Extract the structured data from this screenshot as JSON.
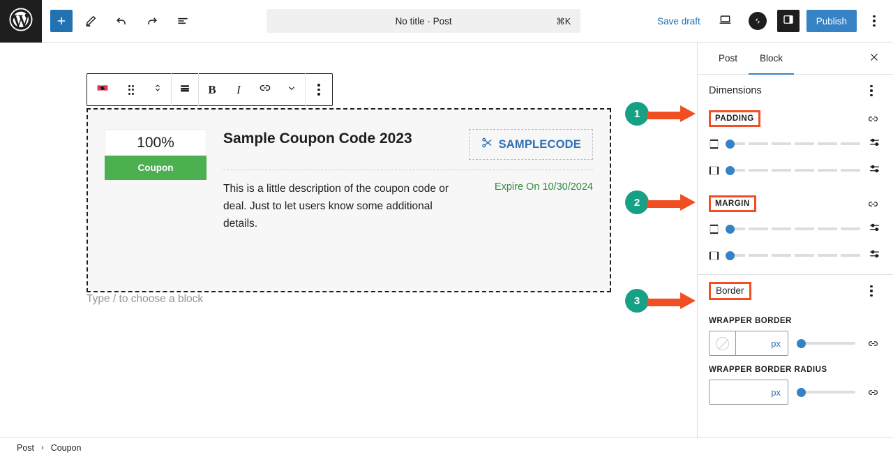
{
  "topbar": {
    "logo_icon": "wordpress-logo",
    "add_block_label": "+",
    "add_block_icon": "plus-icon",
    "tools_icon": "pencil-icon",
    "undo_icon": "undo-arrow-icon",
    "redo_icon": "redo-arrow-icon",
    "list_view_icon": "document-overview-icon",
    "document_title": "No title · Post",
    "command_shortcut": "⌘K",
    "save_draft_label": "Save draft",
    "preview_icon": "laptop-preview-icon",
    "jetpack_icon": "jetpack-icon",
    "settings_toggle_icon": "settings-sidebar-icon",
    "publish_label": "Publish",
    "options_icon": "kebab-menu-icon"
  },
  "block_toolbar": {
    "block_type_icon": "coupon-block-icon",
    "drag_icon": "drag-handle-icon",
    "move_icon": "move-up-down-icon",
    "align_icon": "align-icon",
    "bold_label": "B",
    "italic_label": "I",
    "link_icon": "link-icon",
    "more_formats_icon": "chevron-down-icon",
    "options_icon": "kebab-menu-icon"
  },
  "coupon_block": {
    "discount": "100%",
    "badge_label": "Coupon",
    "title": "Sample Coupon Code 2023",
    "code": "SAMPLECODE",
    "code_icon": "scissors-icon",
    "description": "This is a little description of the coupon code or deal. Just to let users know some additional details.",
    "expire": "Expire On 10/30/2024",
    "badge_color": "#4caf50",
    "code_color": "#2d6fb5",
    "expire_color": "#2e8b3d"
  },
  "canvas": {
    "placeholder": "Type / to choose a block"
  },
  "sidebar": {
    "tabs": [
      {
        "label": "Post",
        "active": false
      },
      {
        "label": "Block",
        "active": true
      }
    ],
    "close_icon": "close-icon",
    "dimensions": {
      "title": "Dimensions",
      "options_icon": "kebab-menu-icon",
      "padding": {
        "label": "PADDING",
        "link_icon": "link-sides-icon",
        "sliders": [
          {
            "edge_icon": "vertical-sides-icon",
            "value": 0,
            "settings_icon": "slider-options-icon"
          },
          {
            "edge_icon": "horizontal-sides-icon",
            "value": 0,
            "settings_icon": "slider-options-icon"
          }
        ]
      },
      "margin": {
        "label": "MARGIN",
        "link_icon": "link-sides-icon",
        "sliders": [
          {
            "edge_icon": "vertical-sides-icon",
            "value": 0,
            "settings_icon": "slider-options-icon"
          },
          {
            "edge_icon": "horizontal-sides-icon",
            "value": 0,
            "settings_icon": "slider-options-icon"
          }
        ]
      }
    },
    "border": {
      "title": "Border",
      "options_icon": "kebab-menu-icon",
      "wrapper_border": {
        "label": "WRAPPER BORDER",
        "color_swatch_icon": "no-color-icon",
        "value": "",
        "unit": "px",
        "link_icon": "link-sides-icon"
      },
      "wrapper_border_radius": {
        "label": "WRAPPER BORDER RADIUS",
        "value": "",
        "unit": "px",
        "link_icon": "link-sides-icon"
      }
    }
  },
  "breadcrumb": {
    "items": [
      "Post",
      "Coupon"
    ],
    "separator": "›"
  },
  "annotations": [
    {
      "number": "1",
      "target": "PADDING"
    },
    {
      "number": "2",
      "target": "MARGIN"
    },
    {
      "number": "3",
      "target": "Border"
    }
  ],
  "colors": {
    "annotation_circle": "#16a085",
    "annotation_arrow": "#f04e23",
    "highlight_box": "#f04e23",
    "accent_blue": "#3582c4"
  }
}
